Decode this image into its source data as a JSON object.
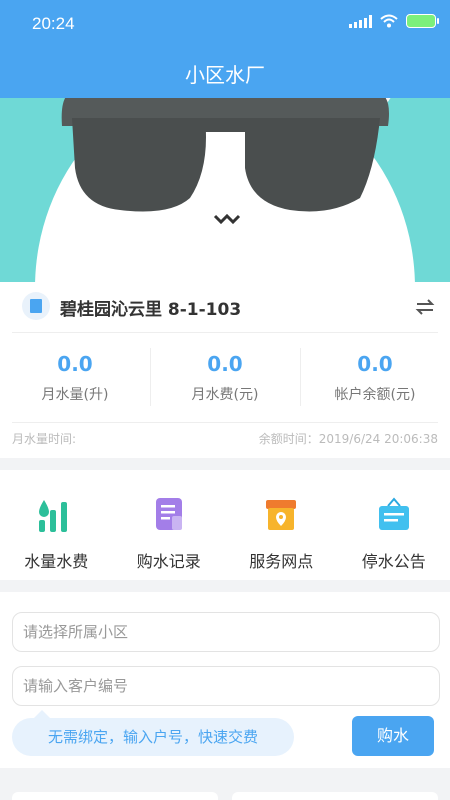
{
  "status_bar": {
    "time": "20:24"
  },
  "header": {
    "title": "小区水厂"
  },
  "account": {
    "address": "碧桂园沁云里 8-1-103",
    "stats": [
      {
        "value": "0.0",
        "label": "月水量(升)"
      },
      {
        "value": "0.0",
        "label": "月水费(元)"
      },
      {
        "value": "0.0",
        "label": "帐户余额(元)"
      }
    ],
    "monthly_time_label": "月水量时间:",
    "balance_time": "余额时间：2019/6/24 20:06:38"
  },
  "menu": [
    {
      "label": "水量水费",
      "icon": "water-usage-icon"
    },
    {
      "label": "购水记录",
      "icon": "purchase-record-icon"
    },
    {
      "label": "服务网点",
      "icon": "service-point-icon"
    },
    {
      "label": "停水公告",
      "icon": "water-outage-notice-icon"
    }
  ],
  "form": {
    "community_placeholder": "请选择所属小区",
    "customer_placeholder": "请输入客户编号",
    "tip": "无需绑定，输入户号，快速交费",
    "buy_label": "购水"
  },
  "colors": {
    "accent": "#4aa5f1"
  }
}
